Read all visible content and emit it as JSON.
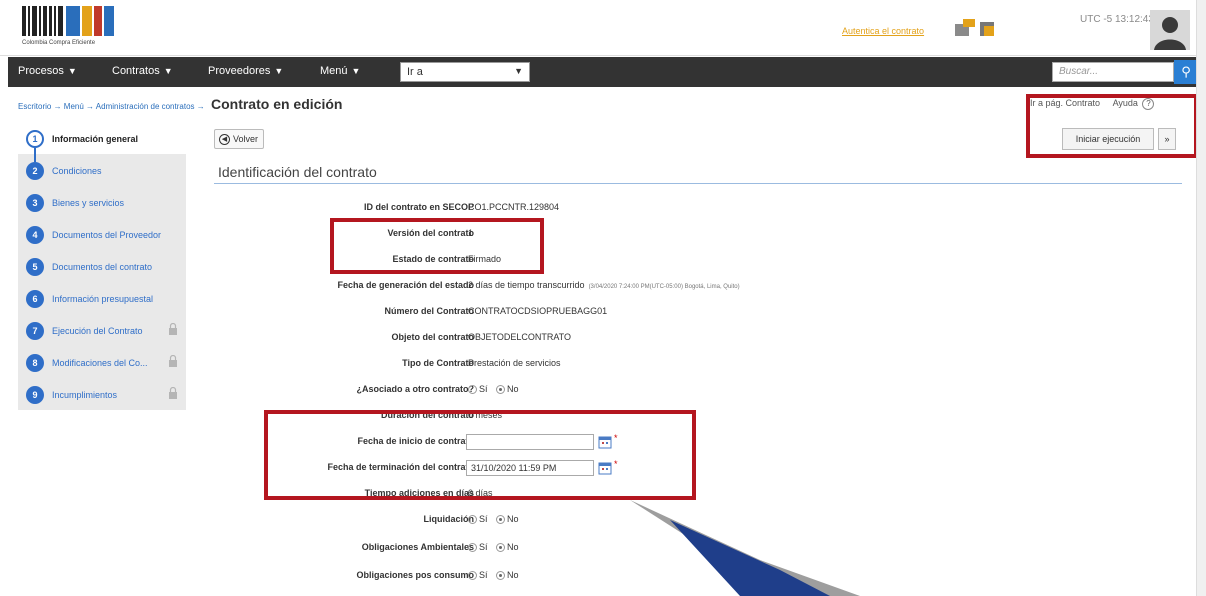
{
  "header": {
    "logo_caption": "Colombia Compra Eficiente",
    "auth_link": "Autentica el contrato",
    "utc": "UTC -5 13:12:43"
  },
  "nav": {
    "items": [
      "Procesos",
      "Contratos",
      "Proveedores",
      "Menú"
    ],
    "goto_value": "Ir a",
    "search_placeholder": "Buscar..."
  },
  "breadcrumb": {
    "path": "Escritorio → Menú → Administración de contratos →",
    "current": "Contrato en edición"
  },
  "topright": {
    "links": "Ir a pág. Contrato",
    "help": "Ayuda"
  },
  "sidebar": {
    "steps": [
      {
        "num": "1",
        "label": "Información general",
        "locked": false
      },
      {
        "num": "2",
        "label": "Condiciones",
        "locked": false
      },
      {
        "num": "3",
        "label": "Bienes y servicios",
        "locked": false
      },
      {
        "num": "4",
        "label": "Documentos del Proveedor",
        "locked": false
      },
      {
        "num": "5",
        "label": "Documentos del contrato",
        "locked": false
      },
      {
        "num": "6",
        "label": "Información presupuestal",
        "locked": false
      },
      {
        "num": "7",
        "label": "Ejecución del Contrato",
        "locked": true
      },
      {
        "num": "8",
        "label": "Modificaciones del Co...",
        "locked": true
      },
      {
        "num": "9",
        "label": "Incumplimientos",
        "locked": true
      }
    ]
  },
  "toolbar": {
    "back_label": "Volver",
    "start_label": "Iniciar ejecución",
    "more_label": "»"
  },
  "section": {
    "title": "Identificación del contrato"
  },
  "fields": {
    "id_secop": {
      "label": "ID del contrato en SECOP",
      "value": "CO1.PCCNTR.129804"
    },
    "version": {
      "label": "Versión del contrato",
      "value": "1"
    },
    "estado": {
      "label": "Estado de contrato",
      "value": "Firmado"
    },
    "fecha_estado": {
      "label": "Fecha de generación del estado",
      "value": "2 días de tiempo transcurrido",
      "detail": "(3/04/2020 7:24:00 PM(UTC-05:00) Bogotá, Lima, Quito)"
    },
    "numero": {
      "label": "Número del Contrato",
      "value": "CONTRATOCDSIOPRUEBAGG01"
    },
    "objeto": {
      "label": "Objeto del contrato",
      "value": "OBJETODELCONTRATO"
    },
    "tipo": {
      "label": "Tipo de Contrato",
      "value": "Prestación de servicios"
    },
    "asociado": {
      "label": "¿Asociado a otro contrato?",
      "yes": "Sí",
      "no": "No"
    },
    "duracion": {
      "label": "Duración del contrato",
      "value": "0 meses"
    },
    "fecha_inicio": {
      "label": "Fecha de inicio de contrato",
      "value": ""
    },
    "fecha_fin": {
      "label": "Fecha de terminación del contrato",
      "value": "31/10/2020 11:59 PM"
    },
    "tiempo_adiciones": {
      "label": "Tiempo adiciones en días",
      "value": "0 días"
    },
    "liquidacion": {
      "label": "Liquidación",
      "yes": "Sí",
      "no": "No"
    },
    "oblig_amb": {
      "label": "Obligaciones Ambientales",
      "yes": "Sí",
      "no": "No"
    },
    "oblig_pos": {
      "label": "Obligaciones pos consumo",
      "yes": "Sí",
      "no": "No"
    }
  },
  "colors": {
    "accent": "#2f6ec8",
    "highlight": "#b4161f",
    "navbar": "#333333"
  }
}
